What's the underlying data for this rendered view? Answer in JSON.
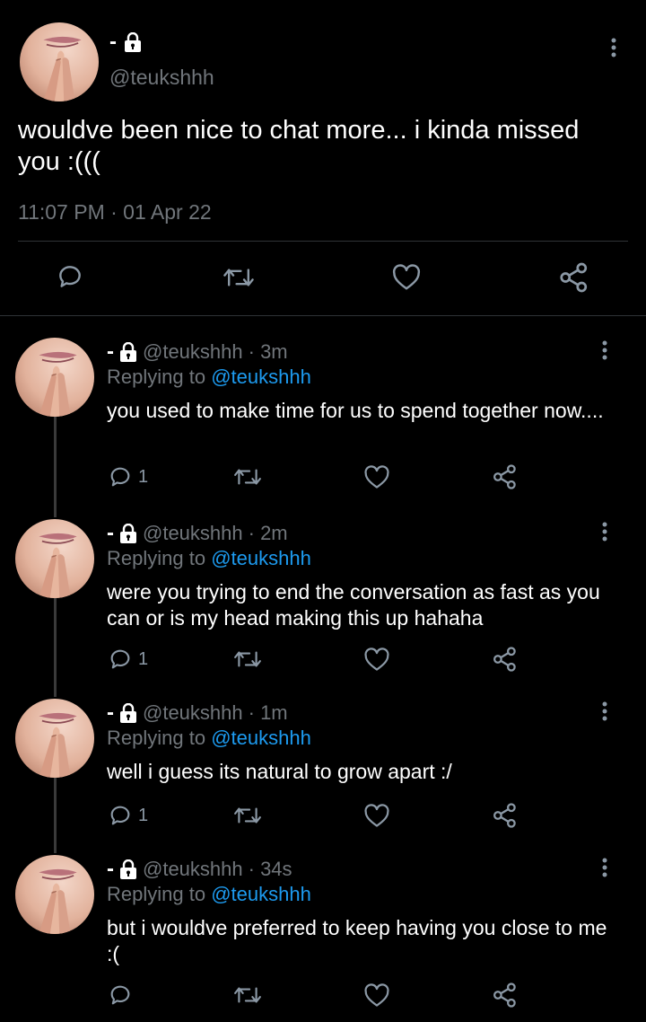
{
  "main_tweet": {
    "display_name": "-",
    "handle": "@teukshhh",
    "text": "wouldve been nice to chat more... i kinda missed you :(((",
    "timestamp": "11:07 PM · 01 Apr 22"
  },
  "replies": [
    {
      "display_name": "-",
      "handle": "@teukshhh",
      "time": "· 3m",
      "replying_label": "Replying to",
      "replying_handle": "@teukshhh",
      "text": "you used to make time for us to spend together now....",
      "reply_count": "1"
    },
    {
      "display_name": "-",
      "handle": "@teukshhh",
      "time": "· 2m",
      "replying_label": "Replying to",
      "replying_handle": "@teukshhh",
      "text": "were you trying to end the conversation as fast as you can or is my head making this up hahaha",
      "reply_count": "1"
    },
    {
      "display_name": "-",
      "handle": "@teukshhh",
      "time": "· 1m",
      "replying_label": "Replying to",
      "replying_handle": "@teukshhh",
      "text": "well i guess its natural to grow apart :/",
      "reply_count": "1"
    },
    {
      "display_name": "-",
      "handle": "@teukshhh",
      "time": "· 34s",
      "replying_label": "Replying to",
      "replying_handle": "@teukshhh",
      "text": "but i wouldve preferred to keep having you close to me :(",
      "reply_count": ""
    }
  ],
  "colors": {
    "background": "#000000",
    "muted": "#71767b",
    "link": "#1d9bf0",
    "text": "#e7e9ea"
  },
  "icons": [
    "lock-icon",
    "more-vertical-icon",
    "reply-icon",
    "retweet-icon",
    "like-icon",
    "share-icon"
  ]
}
